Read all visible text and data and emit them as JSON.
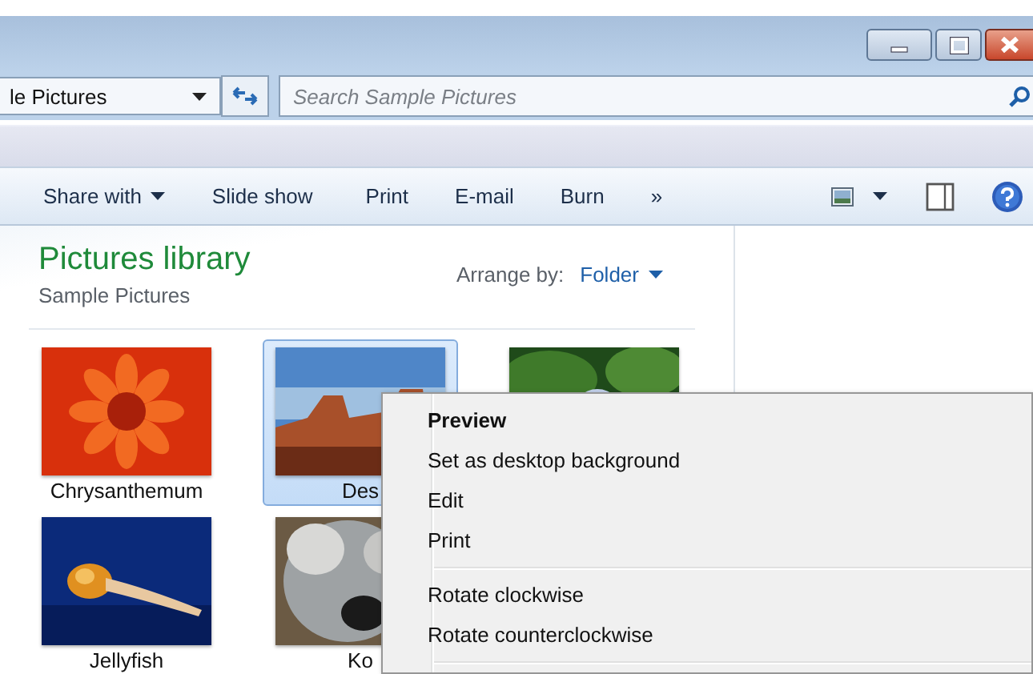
{
  "window": {
    "caption_buttons": [
      {
        "kind": "minimize"
      },
      {
        "kind": "maximize"
      },
      {
        "kind": "close"
      }
    ]
  },
  "address": {
    "value": "le Pictures"
  },
  "search": {
    "placeholder": "Search Sample Pictures"
  },
  "toolbar": {
    "items": [
      {
        "label": "Share with",
        "dropdown": true
      },
      {
        "label": "Slide show",
        "dropdown": false
      },
      {
        "label": "Print",
        "dropdown": false
      },
      {
        "label": "E-mail",
        "dropdown": false
      },
      {
        "label": "Burn",
        "dropdown": false
      },
      {
        "label": "»",
        "dropdown": false
      }
    ]
  },
  "library": {
    "title": "Pictures library",
    "subtitle": "Sample Pictures",
    "arrange_label": "Arrange by:",
    "arrange_value": "Folder"
  },
  "files": [
    {
      "label": "Chrysanthemum",
      "selected": false
    },
    {
      "label": "Des",
      "selected": true
    },
    {
      "selected": false
    },
    {
      "label": "Jellyfish",
      "selected": false
    },
    {
      "label": "Ko",
      "selected": false
    }
  ],
  "context_menu": [
    {
      "kind": "item",
      "label": "Preview",
      "default": true
    },
    {
      "kind": "item",
      "label": "Set as desktop background",
      "default": false
    },
    {
      "kind": "item",
      "label": "Edit",
      "default": false
    },
    {
      "kind": "item",
      "label": "Print",
      "default": false
    },
    {
      "kind": "separator"
    },
    {
      "kind": "item",
      "label": "Rotate clockwise",
      "default": false
    },
    {
      "kind": "item",
      "label": "Rotate counterclockwise",
      "default": false
    },
    {
      "kind": "separator"
    }
  ]
}
